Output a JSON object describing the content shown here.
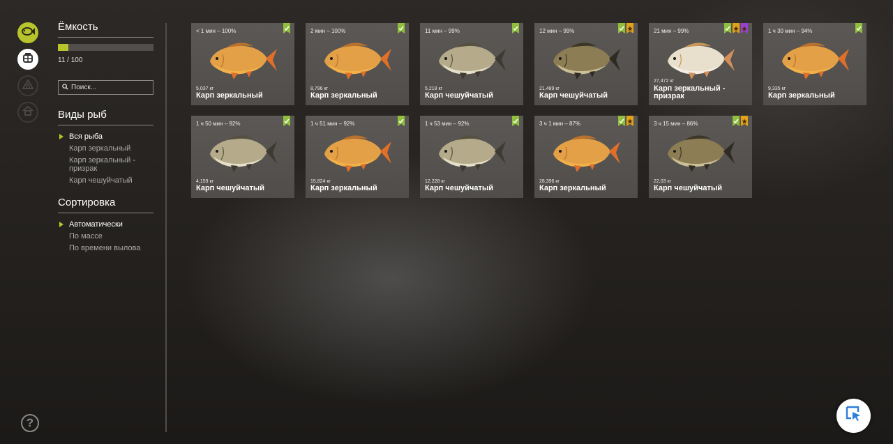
{
  "sidebar": {
    "capacity": {
      "title": "Ёмкость",
      "count": "11 / 100",
      "fill": 0.11
    },
    "search": {
      "placeholder": "Поиск..."
    },
    "species": {
      "title": "Виды рыб",
      "items": [
        "Вся рыба",
        "Карп зеркальный",
        "Карп зеркальный - призрак",
        "Карп чешуйчатый"
      ],
      "selected": 0
    },
    "sort": {
      "title": "Сортировка",
      "items": [
        "Автоматически",
        "По массе",
        "По времени вылова"
      ],
      "selected": 0
    }
  },
  "fish": [
    {
      "time": "< 1 мин – 100%",
      "weight": "5,037 кг",
      "name": "Карп зеркальный",
      "kind": "mirror",
      "badges": [
        "green"
      ]
    },
    {
      "time": "2 мин – 100%",
      "weight": "8,796 кг",
      "name": "Карп зеркальный",
      "kind": "mirror",
      "badges": [
        "green"
      ]
    },
    {
      "time": "11 мин – 99%",
      "weight": "5,218 кг",
      "name": "Карп чешуйчатый",
      "kind": "common",
      "badges": [
        "green"
      ]
    },
    {
      "time": "12 мин – 99%",
      "weight": "21,489 кг",
      "name": "Карп чешуйчатый",
      "kind": "common-dark",
      "badges": [
        "green",
        "gold"
      ]
    },
    {
      "time": "21 мин – 99%",
      "weight": "27,472 кг",
      "name": "Карп зеркальный - призрак",
      "kind": "ghost",
      "badges": [
        "green",
        "gold",
        "purple"
      ]
    },
    {
      "time": "1 ч 30 мин – 94%",
      "weight": "9,335 кг",
      "name": "Карп зеркальный",
      "kind": "mirror",
      "badges": [
        "green"
      ]
    },
    {
      "time": "1 ч 50 мин – 92%",
      "weight": "4,159 кг",
      "name": "Карп чешуйчатый",
      "kind": "common",
      "badges": [
        "green"
      ]
    },
    {
      "time": "1 ч 51 мин – 92%",
      "weight": "15,824 кг",
      "name": "Карп зеркальный",
      "kind": "mirror",
      "badges": [
        "green"
      ]
    },
    {
      "time": "1 ч 53 мин – 92%",
      "weight": "12,228 кг",
      "name": "Карп чешуйчатый",
      "kind": "common",
      "badges": [
        "green"
      ]
    },
    {
      "time": "3 ч 1 мин – 87%",
      "weight": "28,396 кг",
      "name": "Карп зеркальный",
      "kind": "mirror",
      "badges": [
        "green",
        "gold"
      ]
    },
    {
      "time": "3 ч 15 мин – 86%",
      "weight": "22,03 кг",
      "name": "Карп чешуйчатый",
      "kind": "common-dark",
      "badges": [
        "green",
        "gold"
      ]
    }
  ],
  "colors": {
    "accent": "#b8c42b",
    "badge_green": "#8fbf3c",
    "badge_gold": "#e2a21a",
    "badge_purple": "#9b3fd1",
    "card_bg": "#555250"
  },
  "icons": {
    "nav": [
      "fish-icon",
      "keepnet-icon",
      "tent-icon",
      "home-icon"
    ],
    "help": "help-icon",
    "cursor": "cursor-select-icon"
  }
}
